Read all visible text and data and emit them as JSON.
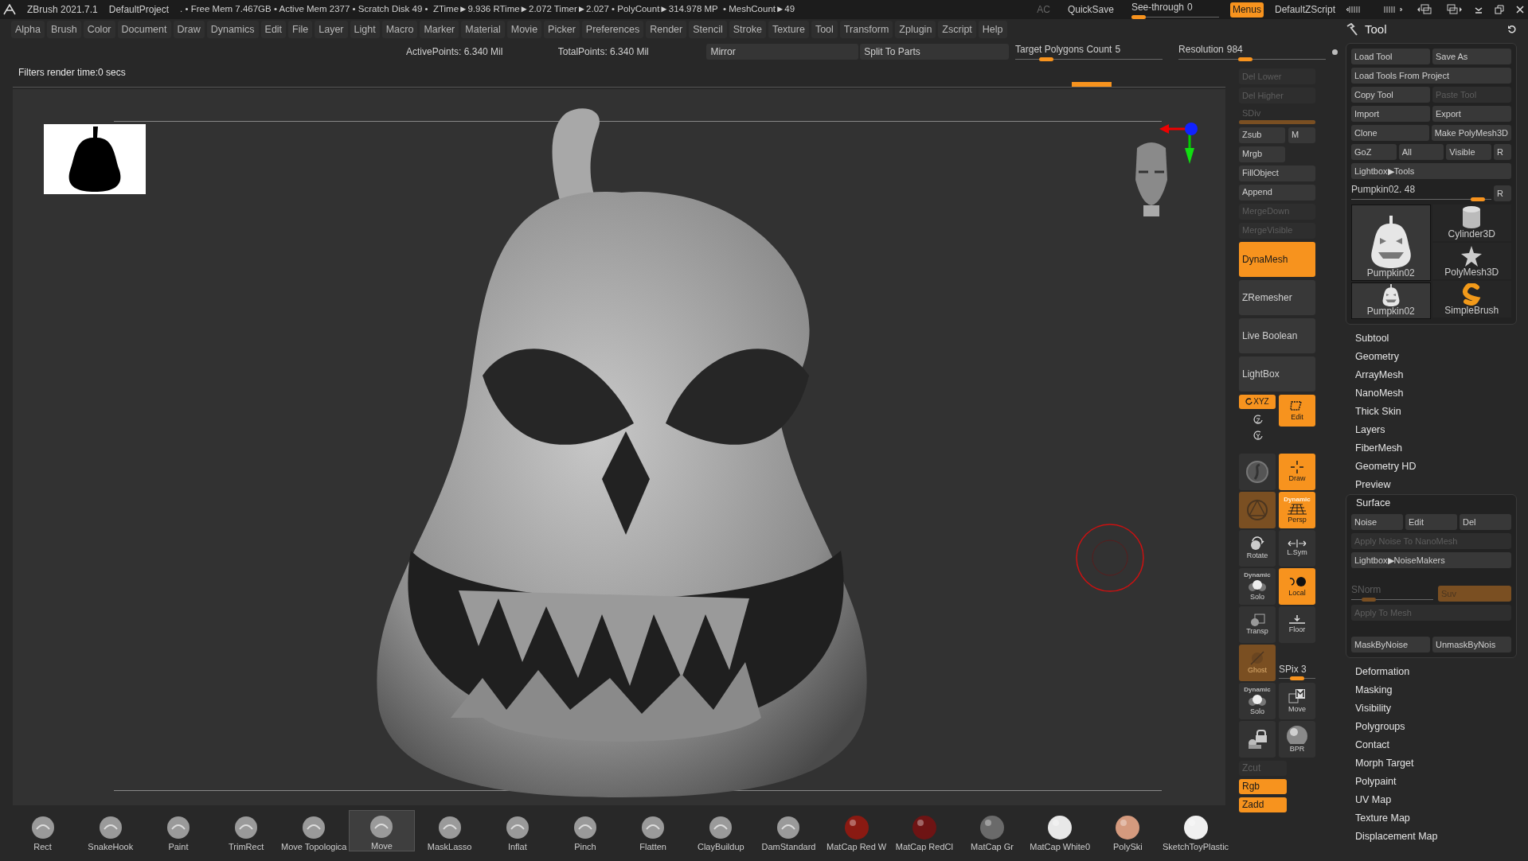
{
  "title_bar": {
    "app": "ZBrush 2021.7.1",
    "project": "DefaultProject",
    "stats": ". • Free Mem 7.467GB • Active Mem 2377 • Scratch Disk 49 •  ZTime►9.936 RTime►2.072 Timer►2.027 • PolyCount►314.978 MP  • MeshCount►49",
    "ac": {
      "label": "AC",
      "disabled": true
    },
    "quicksave": "QuickSave",
    "see_through": {
      "label": "See-through",
      "value": "0",
      "level": 0
    },
    "menus": {
      "label": "Menus",
      "selected": true
    },
    "script": "DefaultZScript"
  },
  "menu_bar": [
    "Alpha",
    "Brush",
    "Color",
    "Document",
    "Draw",
    "Dynamics",
    "Edit",
    "File",
    "Layer",
    "Light",
    "Macro",
    "Marker",
    "Material",
    "Movie",
    "Picker",
    "Preferences",
    "Render",
    "Stencil",
    "Stroke",
    "Texture",
    "Tool",
    "Transform",
    "Zplugin",
    "Zscript",
    "Help"
  ],
  "top_bar": {
    "active_points": "ActivePoints: 6.340 Mil",
    "total_points": "TotalPoints: 6.340 Mil",
    "mirror": "Mirror",
    "split": "Split To Parts",
    "target_polygons": {
      "label": "Target Polygons Count",
      "value": "5",
      "level": 0.18
    },
    "resolution": {
      "label": "Resolution",
      "value": "984",
      "level": 0.45
    }
  },
  "canvas": {
    "filters_text": "Filters render time:0 secs"
  },
  "right_shelf": {
    "stack": [
      {
        "kind": "button",
        "label": "Del Lower",
        "disabled": true,
        "active": false,
        "tall": false
      },
      {
        "kind": "button",
        "label": "Del Higher",
        "disabled": true,
        "active": false,
        "tall": false
      },
      {
        "kind": "slider",
        "label": "SDiv",
        "level": 1,
        "disabled": true
      },
      {
        "kind": "pair",
        "items": [
          {
            "label": "Zsub",
            "disabled": false,
            "active": false
          },
          {
            "label": "M",
            "disabled": false,
            "active": false
          }
        ]
      },
      {
        "kind": "pair",
        "items": [
          {
            "label": "Mrgb",
            "disabled": false,
            "active": false
          }
        ]
      },
      {
        "kind": "button",
        "label": "FillObject",
        "disabled": false,
        "active": false,
        "tall": false
      },
      {
        "kind": "button",
        "label": "Append",
        "disabled": false,
        "active": false,
        "tall": false
      },
      {
        "kind": "button",
        "label": "MergeDown",
        "disabled": true,
        "active": false,
        "tall": false
      },
      {
        "kind": "button",
        "label": "MergeVisible",
        "disabled": true,
        "active": false,
        "tall": false
      },
      {
        "kind": "button",
        "label": "DynaMesh",
        "disabled": false,
        "active": true,
        "tall": true
      },
      {
        "kind": "button",
        "label": "ZRemesher",
        "disabled": false,
        "active": false,
        "tall": true
      },
      {
        "kind": "button",
        "label": "Live Boolean",
        "disabled": false,
        "active": false,
        "tall": true
      },
      {
        "kind": "button",
        "label": "LightBox",
        "disabled": false,
        "active": false,
        "tall": true
      }
    ],
    "tools": [
      {
        "kind": "xyz",
        "label": "XYZ",
        "active": true,
        "dimmed": false
      },
      {
        "kind": "edit",
        "label": "Edit",
        "active": true,
        "dimmed": false
      },
      {
        "kind": "sphere",
        "active": false,
        "dimmed": false
      },
      {
        "kind": "draw",
        "label": "Draw",
        "active": true,
        "dimmed": false
      },
      {
        "kind": "polyframe",
        "active": false,
        "dimmed": true
      },
      {
        "kind": "persp",
        "label": "Persp",
        "active": true,
        "dimmed": false,
        "badge": "Dynamic"
      },
      {
        "kind": "rotate",
        "label": "Rotate",
        "active": false,
        "dimmed": false
      },
      {
        "kind": "lsym",
        "label": "L.Sym",
        "active": false,
        "dimmed": false
      },
      {
        "kind": "solo",
        "label": "Solo",
        "active": false,
        "dimmed": false,
        "badge": "Dynamic"
      },
      {
        "kind": "local",
        "label": "Local",
        "active": true,
        "dimmed": false
      },
      {
        "kind": "transp",
        "label": "Transp",
        "active": false,
        "dimmed": false
      },
      {
        "kind": "floor",
        "label": "Floor",
        "active": false,
        "dimmed": false
      },
      {
        "kind": "ghost",
        "label": "Ghost",
        "active": false,
        "dimmed": true
      },
      {
        "kind": "spix",
        "label": "SPix 3",
        "level": 0.5
      },
      {
        "kind": "solo",
        "label": "Solo",
        "active": false,
        "dimmed": false,
        "badge": "Dynamic"
      },
      {
        "kind": "move",
        "label": "Move",
        "active": false,
        "dimmed": false
      },
      {
        "kind": "camera",
        "active": false,
        "dimmed": false
      },
      {
        "kind": "bpr",
        "label": "BPR",
        "active": false,
        "dimmed": false
      }
    ],
    "bottom": [
      {
        "label": "Zcut",
        "disabled": true,
        "active": false
      },
      {
        "label": "Rgb",
        "disabled": false,
        "active": true
      },
      {
        "label": "Zadd",
        "disabled": false,
        "active": true
      }
    ]
  },
  "tool_panel": {
    "title": "Tool",
    "rows": [
      [
        {
          "label": "Load Tool",
          "disabled": false
        },
        {
          "label": "Save As",
          "disabled": false
        }
      ],
      [
        {
          "label": "Load Tools From Project",
          "disabled": false
        }
      ],
      [
        {
          "label": "Copy Tool",
          "disabled": false
        },
        {
          "label": "Paste Tool",
          "disabled": true
        }
      ],
      [
        {
          "label": "Import",
          "disabled": false
        },
        {
          "label": "Export",
          "disabled": false
        }
      ],
      [
        {
          "label": "Clone",
          "disabled": false
        },
        {
          "label": "Make PolyMesh3D",
          "disabled": false
        }
      ],
      [
        {
          "label": "GoZ",
          "disabled": false
        },
        {
          "label": "All",
          "disabled": false
        },
        {
          "label": "Visible",
          "disabled": false
        },
        {
          "label": "R",
          "disabled": false
        }
      ],
      [
        {
          "label": "Lightbox▶Tools",
          "disabled": false
        }
      ]
    ],
    "tool_slider": {
      "label": "Pumpkin02. 48",
      "level": 0.95,
      "button": "R"
    },
    "thumbnail_columns": [
      [
        {
          "label": "Pumpkin02",
          "kind": "pumpkin",
          "large": true,
          "selected": true
        },
        {
          "label": "Pumpkin02",
          "kind": "pumpkin",
          "large": false,
          "selected": true
        }
      ],
      [
        {
          "label": "Cylinder3D",
          "kind": "cylinder",
          "large": false,
          "selected": false
        },
        {
          "label": "PolyMesh3D",
          "kind": "star",
          "large": false,
          "selected": false
        },
        {
          "label": "SimpleBrush",
          "kind": "simplebrush",
          "large": false,
          "selected": false
        }
      ]
    ],
    "sections_before": [
      "Subtool",
      "Geometry",
      "ArrayMesh",
      "NanoMesh",
      "Thick Skin",
      "Layers",
      "FiberMesh",
      "Geometry HD",
      "Preview"
    ],
    "surface": {
      "title": "Surface",
      "expanded": true,
      "buttons": [
        {
          "label": "Noise",
          "disabled": false
        },
        {
          "label": "Edit",
          "disabled": false
        },
        {
          "label": "Del",
          "disabled": false
        }
      ],
      "apply_nanomesh": {
        "label": "Apply Noise To NanoMesh",
        "disabled": true
      },
      "noisemakers": {
        "label": "Lightbox▶NoiseMakers",
        "disabled": false
      },
      "snorm": {
        "label": "SNorm",
        "level": 0.15,
        "disabled": true
      },
      "suv": {
        "label": "Suv",
        "disabled": true
      },
      "apply_mesh": {
        "label": "Apply To Mesh",
        "disabled": true
      },
      "mask_buttons": [
        {
          "label": "MaskByNoise",
          "disabled": false
        },
        {
          "label": "UnmaskByNois",
          "disabled": false
        }
      ]
    },
    "sections_after": [
      "Deformation",
      "Masking",
      "Visibility",
      "Polygroups",
      "Contact",
      "Morph Target",
      "Polypaint",
      "UV Map",
      "Texture Map",
      "Displacement Map"
    ]
  },
  "shelf": [
    {
      "label": "Rect",
      "kind": "brush",
      "selected": false
    },
    {
      "label": "SnakeHook",
      "kind": "brush",
      "selected": false
    },
    {
      "label": "Paint",
      "kind": "brush",
      "selected": false
    },
    {
      "label": "TrimRect",
      "kind": "brush",
      "selected": false
    },
    {
      "label": "Move Topologica",
      "kind": "brush",
      "selected": false
    },
    {
      "label": "Move",
      "kind": "brush",
      "selected": true
    },
    {
      "label": "MaskLasso",
      "kind": "brush",
      "selected": false
    },
    {
      "label": "Inflat",
      "kind": "brush",
      "selected": false
    },
    {
      "label": "Pinch",
      "kind": "brush",
      "selected": false
    },
    {
      "label": "Flatten",
      "kind": "brush",
      "selected": false
    },
    {
      "label": "ClayBuildup",
      "kind": "brush",
      "selected": false
    },
    {
      "label": "DamStandard",
      "kind": "brush",
      "selected": false
    },
    {
      "label": "MatCap Red W",
      "kind": "material",
      "color": "#8a1a12",
      "selected": false
    },
    {
      "label": "MatCap RedCl",
      "kind": "material",
      "color": "#6e1414",
      "selected": false
    },
    {
      "label": "MatCap Gr",
      "kind": "material",
      "color": "#6a6a6a",
      "selected": false
    },
    {
      "label": "MatCap White0",
      "kind": "material",
      "color": "#e8e8e8",
      "selected": false
    },
    {
      "label": "PolySki",
      "kind": "material",
      "color": "#d49a7e",
      "selected": false
    },
    {
      "label": "SketchToyPlastic",
      "kind": "material",
      "color": "#f0f0f0",
      "selected": false
    }
  ]
}
